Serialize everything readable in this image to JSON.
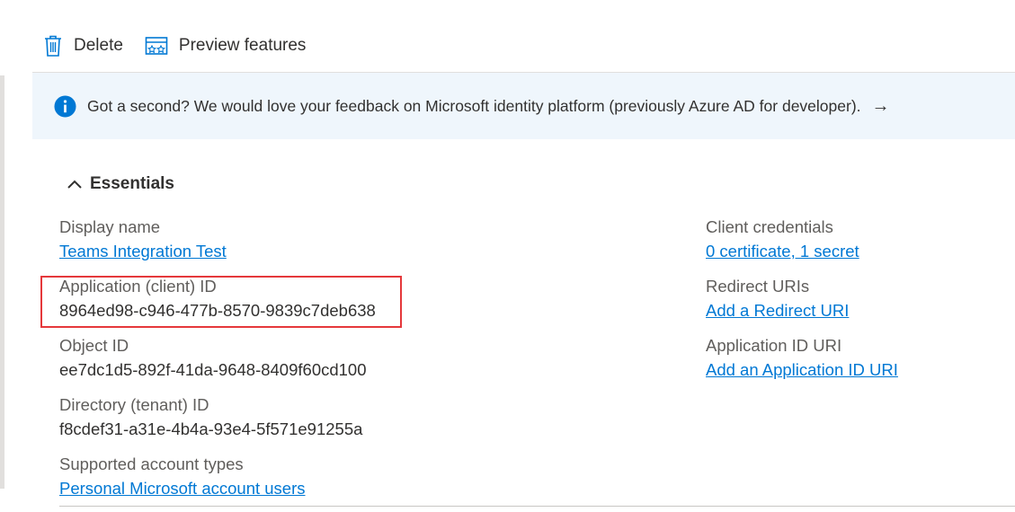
{
  "toolbar": {
    "delete_label": "Delete",
    "preview_label": "Preview features"
  },
  "banner": {
    "text": "Got a second? We would love your feedback on Microsoft identity platform (previously Azure AD for developer).",
    "arrow": "→",
    "accent": "#0078d4",
    "background": "#eff6fc"
  },
  "essentials": {
    "title": "Essentials",
    "left": [
      {
        "label": "Display name",
        "value": "Teams Integration Test",
        "is_link": true
      },
      {
        "label": "Application (client) ID",
        "value": "8964ed98-c946-477b-8570-9839c7deb638",
        "is_link": false
      },
      {
        "label": "Object ID",
        "value": "ee7dc1d5-892f-41da-9648-8409f60cd100",
        "is_link": false
      },
      {
        "label": "Directory (tenant) ID",
        "value": "f8cdef31-a31e-4b4a-93e4-5f571e91255a",
        "is_link": false
      },
      {
        "label": "Supported account types",
        "value": "Personal Microsoft account users",
        "is_link": true
      }
    ],
    "right": [
      {
        "label": "Client credentials",
        "value": "0 certificate, 1 secret",
        "is_link": true
      },
      {
        "label": "Redirect URIs",
        "value": "Add a Redirect URI",
        "is_link": true
      },
      {
        "label": "Application ID URI",
        "value": "Add an Application ID URI",
        "is_link": true
      }
    ]
  },
  "colors": {
    "link": "#0078d4",
    "highlight": "#e5383b"
  }
}
